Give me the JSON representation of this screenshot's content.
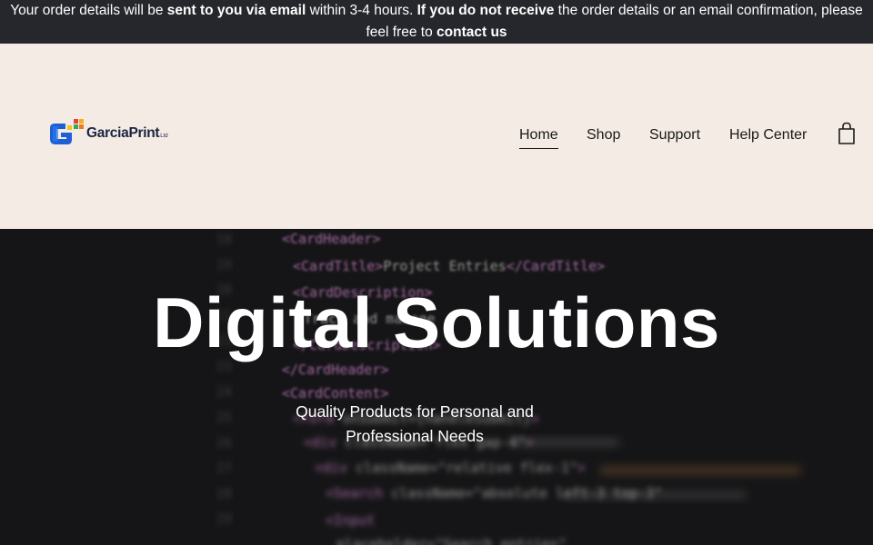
{
  "announcement": {
    "part1": "Your order details will be ",
    "bold1": "sent to you via email",
    "part2": " within 3-4 hours. ",
    "bold2": "If you do not receive",
    "part3": " the order details or an email confirmation, please feel free to ",
    "bold3": "contact us"
  },
  "header": {
    "logo_text": "GarciaPrint",
    "logo_suffix": "Ltd",
    "nav": [
      "Home",
      "Shop",
      "Support",
      "Help Center"
    ],
    "active_nav": "Home",
    "cart_icon": "shopping-bag-icon"
  },
  "hero": {
    "title": "Digital Solutions",
    "subtitle": "Quality Products for Personal and Professional Needs",
    "background": "blurred-code-editor-image"
  },
  "colors": {
    "announcement_bg": "#26272c",
    "header_bg": "#f3ebe4",
    "hero_bg": "#1d1d1f",
    "code_tag": "#d98ad8",
    "code_text": "#b8b8b8",
    "code_accent": "#f0a050"
  }
}
